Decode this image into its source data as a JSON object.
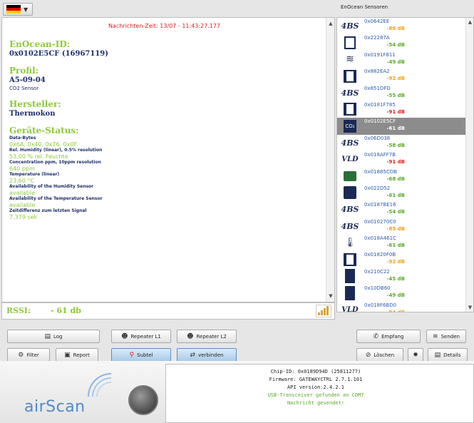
{
  "header": {
    "flag_colors": [
      "#000000",
      "#dd0000",
      "#ffce00"
    ],
    "right_title": "EnOcean Sensoren"
  },
  "detail": {
    "time_line": "Nachrichten-Zeit: 13/07 - 11:43:27.177",
    "enocean_id_title": "EnOcean-ID:",
    "enocean_id_value": "0x0102E5CF (16967119)",
    "profil_title": "Profil:",
    "profil_value": "A5-09-04",
    "profil_desc": "CO2 Sensor",
    "hersteller_title": "Hersteller:",
    "hersteller_value": "Thermokon",
    "geraete_title": "Geräte-Status:",
    "fields": [
      {
        "label": "Data-Bytes",
        "value": "0x6A, 0x40, 0x76, 0x0F"
      },
      {
        "label": "Rel. Humidity (linear), 0.5% resolution",
        "value": "53,00 % rel. Feuchte"
      },
      {
        "label": "Concentration ppm, 10ppm resolution",
        "value": "640 ppm"
      },
      {
        "label": "Temperature (linear)",
        "value": "23,60 °C"
      },
      {
        "label": "Availability of the Humidity Sensor",
        "value": "available"
      },
      {
        "label": "Availability of the Temperature Sensor",
        "value": "available"
      },
      {
        "label": "Zeitdifferenz zum letzten Signal",
        "value": "7.379 sek"
      }
    ]
  },
  "rssi": {
    "label": "RSSI:",
    "value": "- 61 db"
  },
  "sensors": [
    {
      "id": "0x0642EE",
      "db": "-86 dB",
      "color": "#f0a020",
      "icon": "4bs-icon"
    },
    {
      "id": "0x22287A",
      "db": "-54 dB",
      "color": "#5aaa2a",
      "icon": "window-icon"
    },
    {
      "id": "0x0191F811",
      "db": "-49 dB",
      "color": "#5aaa2a",
      "icon": "wifi-icon"
    },
    {
      "id": "0x882EA2",
      "db": "-92 dB",
      "color": "#f0a020",
      "icon": "double-window-icon"
    },
    {
      "id": "0x851DFD",
      "db": "-55 dB",
      "color": "#5aaa2a",
      "icon": "4bs-icon"
    },
    {
      "id": "0x0181F785",
      "db": "-91 dB",
      "color": "#e02020",
      "icon": "double-window-icon"
    },
    {
      "id": "0x0102E5CF",
      "db": "-61 dB",
      "color": "#ffffff",
      "icon": "co2-icon",
      "selected": true
    },
    {
      "id": "0x06D038",
      "db": "-58 dB",
      "color": "#5aaa2a",
      "icon": "4bs-icon"
    },
    {
      "id": "0x018AFF7B",
      "db": "-91 dB",
      "color": "#e02020",
      "icon": "vld-icon"
    },
    {
      "id": "0x01885CDB",
      "db": "-68 dB",
      "color": "#5aaa2a",
      "icon": "device-icon"
    },
    {
      "id": "0x022D52",
      "db": "-61 dB",
      "color": "#5aaa2a",
      "icon": "switch-icon"
    },
    {
      "id": "0x0187BE16",
      "db": "-54 dB",
      "color": "#5aaa2a",
      "icon": "4bs-icon"
    },
    {
      "id": "0x010270C0",
      "db": "-85 dB",
      "color": "#f0a020",
      "icon": "4bs-icon"
    },
    {
      "id": "0x018A461C",
      "db": "-61 dB",
      "color": "#5aaa2a",
      "icon": "thermo-icon"
    },
    {
      "id": "0x01820F0B",
      "db": "-92 dB",
      "color": "#f0a020",
      "icon": "double-window-icon"
    },
    {
      "id": "0x210C22",
      "db": "-45 dB",
      "color": "#5aaa2a",
      "icon": "door-icon"
    },
    {
      "id": "0x10DB60",
      "db": "-49 dB",
      "color": "#5aaa2a",
      "icon": "door-icon"
    },
    {
      "id": "0x018F6BD0",
      "db": "-94 dB",
      "color": "#f0a020",
      "icon": "vld-icon"
    }
  ],
  "buttons": {
    "log": "Log",
    "repeater_l1": "Repeater L1",
    "repeater_l2": "Repeater L2",
    "empfang": "Empfang",
    "senden": "Senden",
    "filter": "Filter",
    "report": "Report",
    "subtel": "Subtel",
    "verbinden": "verbinden",
    "loeschen": "Löschen",
    "details": "Details"
  },
  "footer": {
    "logo": "airScan",
    "chip_id": "Chip-ID: 0x0189D94D (25811277)",
    "firmware": "Firmware: GATEWAYCTRL 2.7.1.101",
    "api": "API version:2.4.2.1",
    "usb": "USB-Transceiver gefunden an COM7",
    "sent": "Nachricht gesendet!"
  }
}
